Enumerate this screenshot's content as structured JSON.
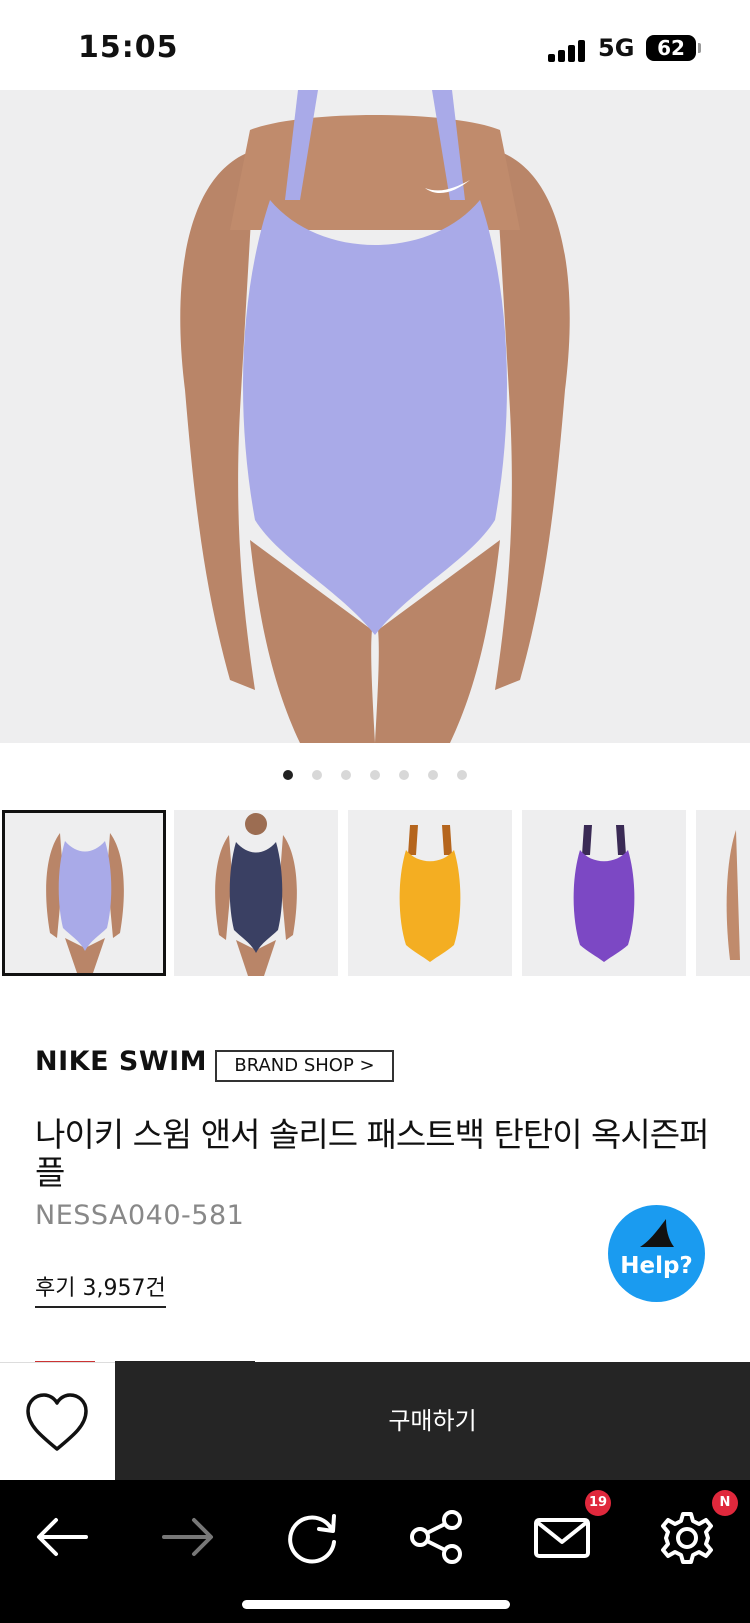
{
  "status": {
    "time": "15:05",
    "network": "5G",
    "battery": "62"
  },
  "gallery": {
    "dots_total": 7,
    "active_dot": 1,
    "main_color": "#a9aae8",
    "thumb_colors": [
      "#a9aae8",
      "#3a4063",
      "#f4ae22",
      "#7c48c4"
    ]
  },
  "product": {
    "brand": "NIKE SWIM",
    "brand_shop": "BRAND SHOP >",
    "title": "나이키 스윔 앤서 솔리드 패스트백 탄탄이 옥시즌퍼플",
    "code": "NESSA040-581",
    "reviews": "후기 3,957건"
  },
  "help": {
    "label": "Help?"
  },
  "buy_bar": {
    "buy_label": "구매하기"
  },
  "browser_nav": {
    "mail_badge": "19",
    "settings_badge": "N"
  }
}
